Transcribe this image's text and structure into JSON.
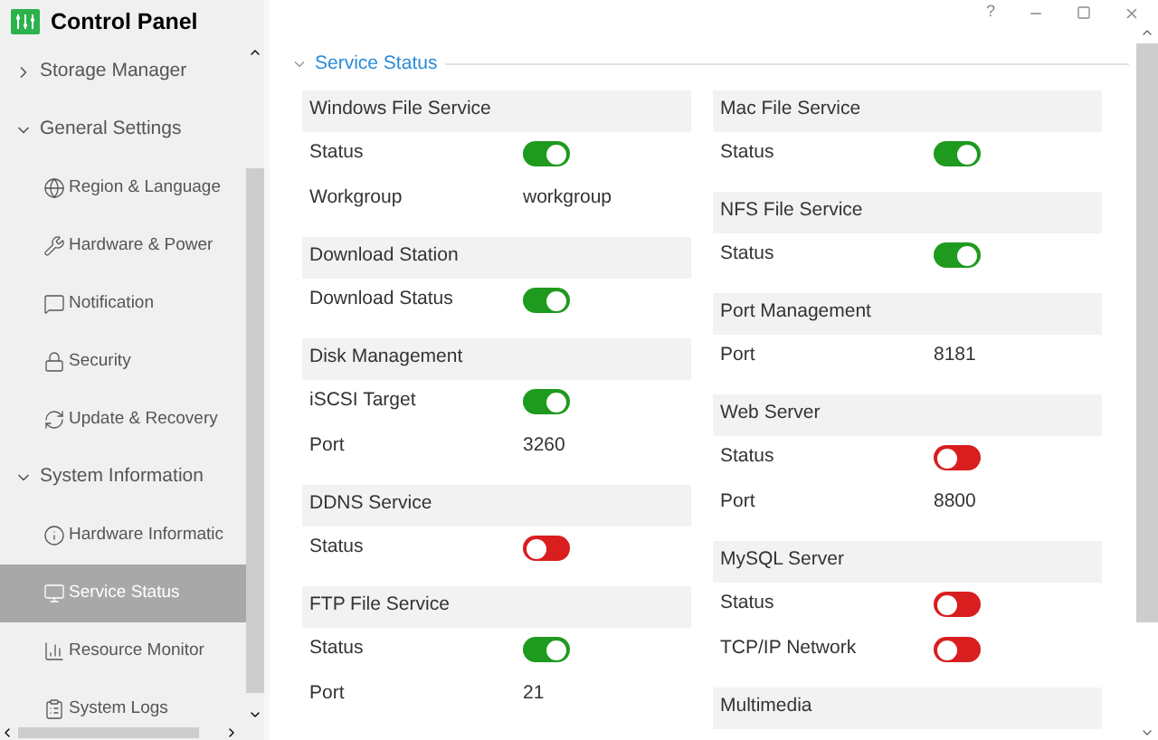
{
  "window": {
    "title": "Control Panel",
    "help": "?"
  },
  "sidebar": {
    "items": [
      {
        "label": "Storage Manager",
        "expanded": false,
        "selected": false
      },
      {
        "label": "General Settings",
        "expanded": true,
        "selected": false,
        "children": [
          {
            "label": "Region & Language",
            "selected": false
          },
          {
            "label": "Hardware & Power",
            "selected": false
          },
          {
            "label": "Notification",
            "selected": false
          },
          {
            "label": "Security",
            "selected": false
          },
          {
            "label": "Update & Recovery",
            "selected": false
          }
        ]
      },
      {
        "label": "System Information",
        "expanded": true,
        "selected": false,
        "children": [
          {
            "label": "Hardware Informatic",
            "selected": false
          },
          {
            "label": "Service Status",
            "selected": true
          },
          {
            "label": "Resource Monitor",
            "selected": false
          },
          {
            "label": "System Logs",
            "selected": false
          }
        ]
      }
    ]
  },
  "section": {
    "title": "Service Status",
    "expanded": true
  },
  "columns": [
    [
      {
        "title": "Windows File Service",
        "rows": [
          {
            "kind": "toggle",
            "label": "Status",
            "on": true
          },
          {
            "kind": "text",
            "label": "Workgroup",
            "value": "workgroup"
          }
        ]
      },
      {
        "title": "Download Station",
        "rows": [
          {
            "kind": "toggle",
            "label": "Download Status",
            "on": true
          }
        ]
      },
      {
        "title": "Disk Management",
        "rows": [
          {
            "kind": "toggle",
            "label": "iSCSI Target",
            "on": true
          },
          {
            "kind": "text",
            "label": "Port",
            "value": "3260"
          }
        ]
      },
      {
        "title": "DDNS Service",
        "rows": [
          {
            "kind": "toggle",
            "label": "Status",
            "on": false
          }
        ]
      },
      {
        "title": "FTP File Service",
        "rows": [
          {
            "kind": "toggle",
            "label": "Status",
            "on": true
          },
          {
            "kind": "text",
            "label": "Port",
            "value": "21"
          }
        ]
      }
    ],
    [
      {
        "title": "Mac File Service",
        "rows": [
          {
            "kind": "toggle",
            "label": "Status",
            "on": true
          }
        ]
      },
      {
        "title": "NFS File Service",
        "rows": [
          {
            "kind": "toggle",
            "label": "Status",
            "on": true
          }
        ]
      },
      {
        "title": "Port Management",
        "rows": [
          {
            "kind": "text",
            "label": "Port",
            "value": "8181"
          }
        ]
      },
      {
        "title": "Web Server",
        "rows": [
          {
            "kind": "toggle",
            "label": "Status",
            "on": false
          },
          {
            "kind": "text",
            "label": "Port",
            "value": "8800"
          }
        ]
      },
      {
        "title": "MySQL Server",
        "rows": [
          {
            "kind": "toggle",
            "label": "Status",
            "on": false
          },
          {
            "kind": "toggle",
            "label": "TCP/IP Network",
            "on": false
          }
        ]
      },
      {
        "title": "Multimedia"
      }
    ]
  ]
}
